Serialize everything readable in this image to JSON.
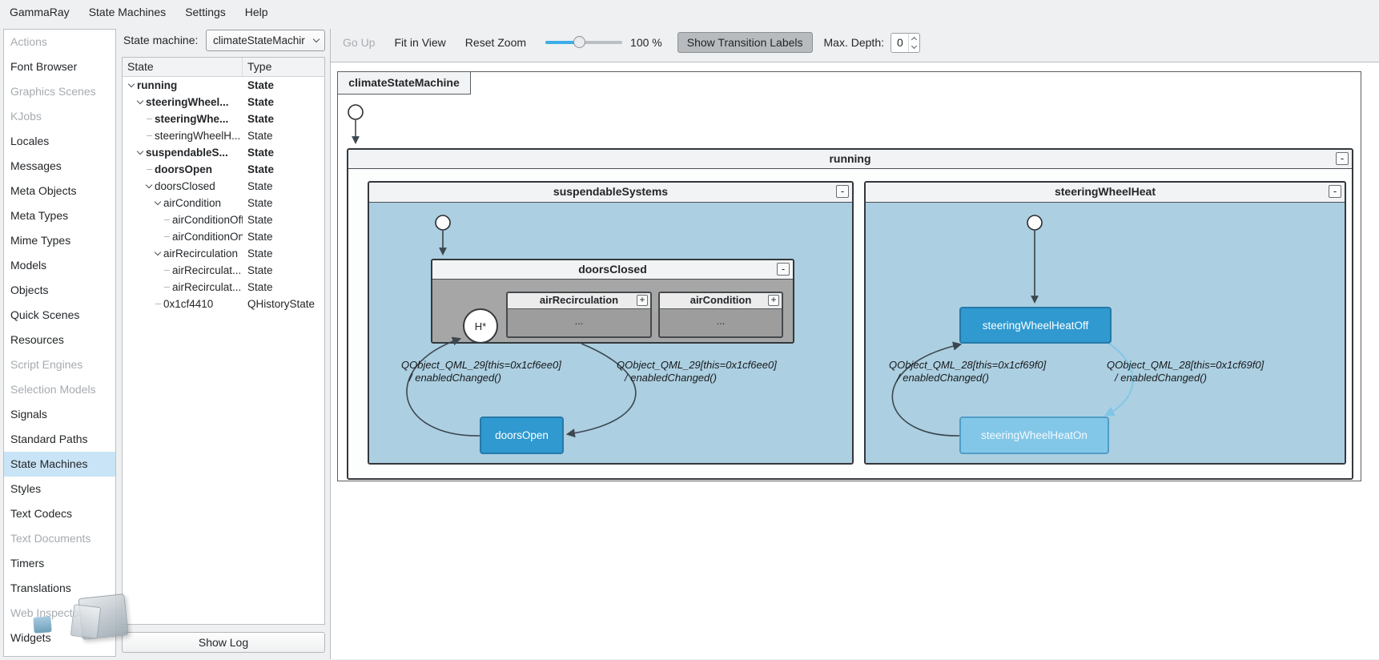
{
  "colors": {
    "accent": "#3daee9",
    "selection_bg": "#c9e4f6",
    "active_state_fill": "#2f99d0",
    "active_state_border": "#2679a8",
    "substate_on_fill": "#83c7e8",
    "substate_on_border": "#4f9ec6",
    "composite_fill": "#accfe1",
    "disabled_fill": "#a6a6a6",
    "collapsed_fill": "#9d9d9d",
    "transition_dark": "#3c4750",
    "transition_light": "#7fc5e8"
  },
  "menu_bar": {
    "items": [
      "GammaRay",
      "State Machines",
      "Settings",
      "Help"
    ]
  },
  "sidebar": {
    "items": [
      {
        "label": "Actions",
        "disabled": true
      },
      {
        "label": "Font Browser"
      },
      {
        "label": "Graphics Scenes",
        "disabled": true
      },
      {
        "label": "KJobs",
        "disabled": true
      },
      {
        "label": "Locales"
      },
      {
        "label": "Messages"
      },
      {
        "label": "Meta Objects"
      },
      {
        "label": "Meta Types"
      },
      {
        "label": "Mime Types"
      },
      {
        "label": "Models"
      },
      {
        "label": "Objects"
      },
      {
        "label": "Quick Scenes"
      },
      {
        "label": "Resources"
      },
      {
        "label": "Script Engines",
        "disabled": true
      },
      {
        "label": "Selection Models",
        "disabled": true
      },
      {
        "label": "Signals"
      },
      {
        "label": "Standard Paths"
      },
      {
        "label": "State Machines",
        "selected": true
      },
      {
        "label": "Styles"
      },
      {
        "label": "Text Codecs"
      },
      {
        "label": "Text Documents",
        "disabled": true
      },
      {
        "label": "Timers"
      },
      {
        "label": "Translations"
      },
      {
        "label": "Web Inspector",
        "disabled": true
      },
      {
        "label": "Widgets"
      }
    ]
  },
  "machine_panel": {
    "label": "State machine:",
    "combo_value": "climateStateMachir",
    "tree": {
      "columns": [
        "State",
        "Type"
      ],
      "rows": [
        {
          "label": "running",
          "type": "State",
          "depth": 0,
          "bold": true,
          "expandable": true
        },
        {
          "label": "steeringWheel...",
          "type": "State",
          "depth": 1,
          "bold": true,
          "expandable": true
        },
        {
          "label": "steeringWhe...",
          "type": "State",
          "depth": 2,
          "bold": true,
          "expandable": false
        },
        {
          "label": "steeringWheelH...",
          "type": "State",
          "depth": 2,
          "bold": false,
          "expandable": false
        },
        {
          "label": "suspendableS...",
          "type": "State",
          "depth": 1,
          "bold": true,
          "expandable": true
        },
        {
          "label": "doorsOpen",
          "type": "State",
          "depth": 2,
          "bold": true,
          "expandable": false
        },
        {
          "label": "doorsClosed",
          "type": "State",
          "depth": 2,
          "bold": false,
          "expandable": true
        },
        {
          "label": "airCondition",
          "type": "State",
          "depth": 3,
          "bold": false,
          "expandable": true
        },
        {
          "label": "airConditionOff",
          "type": "State",
          "depth": 4,
          "bold": false,
          "expandable": false
        },
        {
          "label": "airConditionOn",
          "type": "State",
          "depth": 4,
          "bold": false,
          "expandable": false
        },
        {
          "label": "airRecirculation",
          "type": "State",
          "depth": 3,
          "bold": false,
          "expandable": true
        },
        {
          "label": "airRecirculat...",
          "type": "State",
          "depth": 4,
          "bold": false,
          "expandable": false
        },
        {
          "label": "airRecirculat...",
          "type": "State",
          "depth": 4,
          "bold": false,
          "expandable": false
        },
        {
          "label": "0x1cf4410",
          "type": "QHistoryState",
          "depth": 3,
          "bold": false,
          "expandable": false
        }
      ]
    },
    "show_log": "Show Log"
  },
  "toolbar": {
    "go_up": "Go Up",
    "fit_in_view": "Fit in View",
    "reset_zoom": "Reset Zoom",
    "zoom_percent": "100 %",
    "show_transition_labels": "Show Transition Labels",
    "max_depth_label": "Max. Depth:",
    "max_depth_value": "0"
  },
  "diagram": {
    "machine_label": "climateStateMachine",
    "running_title": "running",
    "suspendable_title": "suspendableSystems",
    "steering_title": "steeringWheelHeat",
    "doors_closed_title": "doorsClosed",
    "air_recirculation_title": "airRecirculation",
    "air_condition_title": "airCondition",
    "collapsed_content": "...",
    "history_label": "H*",
    "doors_open_label": "doorsOpen",
    "heat_off_label": "steeringWheelHeatOff",
    "heat_on_label": "steeringWheelHeatOn",
    "collapse_glyph": "-",
    "expand_glyph": "+",
    "transitions": {
      "doors_left": {
        "line1": "QObject_QML_29[this=0x1cf6ee0]",
        "line2": "/ enabledChanged()"
      },
      "doors_right": {
        "line1": "QObject_QML_29[this=0x1cf6ee0]",
        "line2": "/ enabledChanged()"
      },
      "steering_left": {
        "line1": "QObject_QML_28[this=0x1cf69f0]",
        "line2": "/ enabledChanged()"
      },
      "steering_right": {
        "line1": "QObject_QML_28[this=0x1cf69f0]",
        "line2": "/ enabledChanged()"
      }
    }
  }
}
